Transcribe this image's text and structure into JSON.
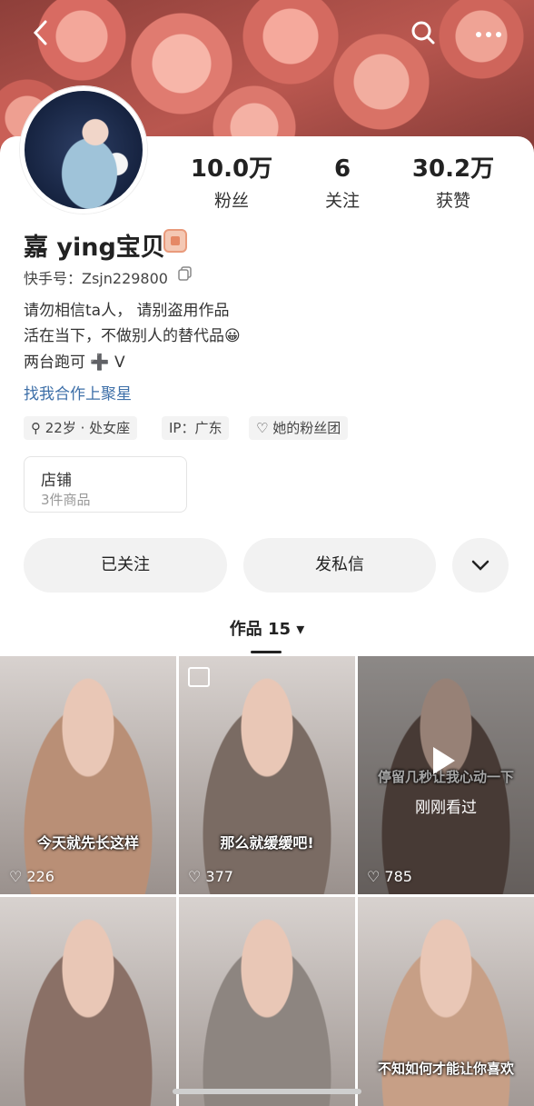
{
  "header": {
    "back_icon": "back-arrow-icon",
    "search_icon": "search-icon",
    "more_icon": "more-dots-icon"
  },
  "profile": {
    "avatar_icon": "avatar",
    "stats": [
      {
        "value": "10.0万",
        "label": "粉丝"
      },
      {
        "value": "6",
        "label": "关注"
      },
      {
        "value": "30.2万",
        "label": "获赞"
      }
    ],
    "name": "嘉 ying宝贝",
    "kuaishou_id": "快手号：Zsjn229800",
    "bio_lines": [
      "请勿相信ta人， 请别盗用作品",
      "活在当下，不做别人的替代品😀",
      "两台跑可 ➕ V"
    ],
    "link": "找我合作上聚星",
    "tags": [
      "⚲ 22岁 · 处女座",
      "IP：广东",
      "♡ 她的粉丝团"
    ],
    "shop": {
      "title": "店铺",
      "subtitle": "3件商品"
    }
  },
  "actions": {
    "follow_label": "已关注",
    "message_label": "发私信",
    "more_icon": "chevron-down-icon"
  },
  "tab": {
    "label": "作品 15 ▾"
  },
  "works": [
    {
      "caption": "今天就先长这样",
      "likes": "♡ 226",
      "bg": "#b98f76"
    },
    {
      "caption": "那么就缓缓吧!",
      "likes": "♡ 377",
      "bg": "#7a6b63"
    },
    {
      "caption": "停留几秒让我心动一下",
      "likes": "♡ 785",
      "bg": "#6e5a52",
      "seen": "刚刚看过"
    },
    {
      "caption": "",
      "likes": "",
      "bg": "#8a7066"
    },
    {
      "caption": "",
      "likes": "",
      "bg": "#8d8580"
    },
    {
      "caption": "不知如何才能让你喜欢",
      "likes": "",
      "bg": "#c79f86"
    }
  ]
}
